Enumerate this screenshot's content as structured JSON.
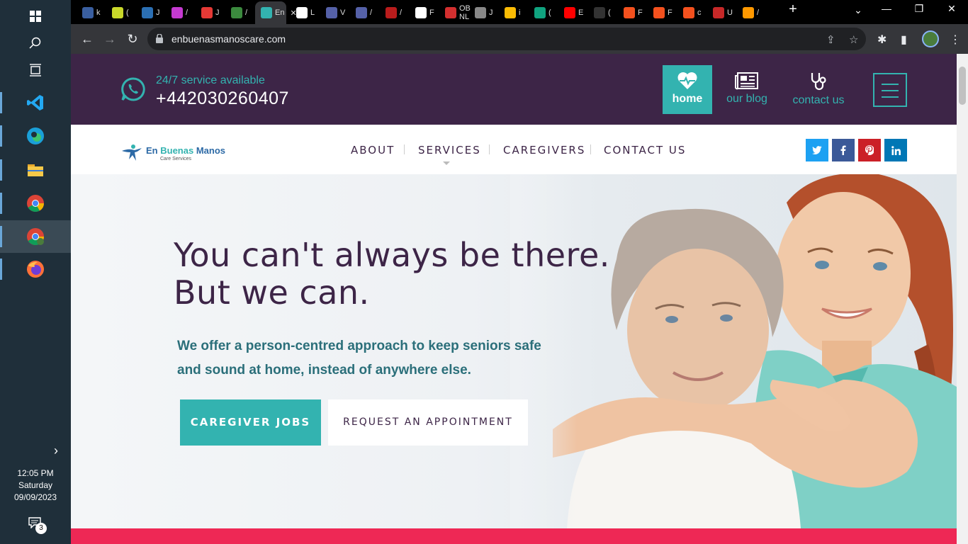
{
  "taskbar": {
    "apps": [
      {
        "name": "windows-start",
        "active": false
      },
      {
        "name": "search",
        "active": false
      },
      {
        "name": "task-view",
        "active": false
      },
      {
        "name": "vscode",
        "active": false
      },
      {
        "name": "edge",
        "active": false
      },
      {
        "name": "file-explorer",
        "active": false
      },
      {
        "name": "chrome",
        "active": false
      },
      {
        "name": "chrome-profile",
        "active": true
      },
      {
        "name": "firefox",
        "active": false
      }
    ],
    "clock": {
      "time": "12:05 PM",
      "day": "Saturday",
      "date": "09/09/2023"
    },
    "notification_count": "3"
  },
  "browser": {
    "tabs": [
      {
        "title": "k",
        "icon_color": "#3a5fa0"
      },
      {
        "title": "(",
        "icon_color": "#c9d82a"
      },
      {
        "title": "J",
        "icon_color": "#2b6fb3"
      },
      {
        "title": "/",
        "icon_color": "#c53ad1"
      },
      {
        "title": "J",
        "icon_color": "#e53935"
      },
      {
        "title": "/",
        "icon_color": "#3b8a3e"
      },
      {
        "title": "En",
        "icon_color": "#33b3b0",
        "active": true
      },
      {
        "title": "L",
        "icon_color": "#ffffff"
      },
      {
        "title": "V",
        "icon_color": "#5561a8"
      },
      {
        "title": "/",
        "icon_color": "#5561a8"
      },
      {
        "title": "/",
        "icon_color": "#b91c1c"
      },
      {
        "title": "F",
        "icon_color": "#ffffff"
      },
      {
        "title": "OB NL",
        "icon_color": "#d32f2f"
      },
      {
        "title": "J",
        "icon_color": "#888888"
      },
      {
        "title": "i",
        "icon_color": "#fbbc04"
      },
      {
        "title": "(",
        "icon_color": "#10a37f"
      },
      {
        "title": "E",
        "icon_color": "#ff0000"
      },
      {
        "title": "(",
        "icon_color": "#333333"
      },
      {
        "title": "F",
        "icon_color": "#f4511e"
      },
      {
        "title": "F",
        "icon_color": "#f4511e"
      },
      {
        "title": "c",
        "icon_color": "#f4511e"
      },
      {
        "title": "U",
        "icon_color": "#c62828"
      },
      {
        "title": "/",
        "icon_color": "#ff9900"
      }
    ],
    "url": "enbuenasmanoscare.com"
  },
  "site": {
    "topbar": {
      "service_text": "24/7 service available",
      "phone": "+442030260407",
      "quick_nav": [
        {
          "label": "home",
          "icon": "heart-pulse-icon",
          "active": true
        },
        {
          "label": "our blog",
          "icon": "newspaper-icon",
          "active": false
        },
        {
          "label": "contact us",
          "icon": "stethoscope-icon",
          "active": false
        }
      ]
    },
    "logo": {
      "line1_a": "En",
      "line1_b": "Buenas",
      "line1_c": "Manos",
      "line2": "Care Services"
    },
    "menu": [
      "ABOUT",
      "SERVICES",
      "CAREGIVERS",
      "CONTACT US"
    ],
    "social": [
      {
        "name": "twitter",
        "glyph": "t",
        "color": "#1da1f2"
      },
      {
        "name": "facebook",
        "glyph": "f",
        "color": "#3b5998"
      },
      {
        "name": "pinterest",
        "glyph": "p",
        "color": "#cb2027"
      },
      {
        "name": "linkedin",
        "glyph": "in",
        "color": "#0077b5"
      }
    ],
    "hero": {
      "headline_1": "You can't always be there.",
      "headline_2": "But we can.",
      "subtext": "We offer a person-centred approach to keep seniors safe and sound at home, instead of anywhere else.",
      "primary_button": "CAREGIVER JOBS",
      "secondary_button": "REQUEST AN APPOINTMENT"
    }
  },
  "colors": {
    "brand_purple": "#3d2547",
    "brand_teal": "#33b3b0",
    "accent_pink": "#ee2855"
  }
}
